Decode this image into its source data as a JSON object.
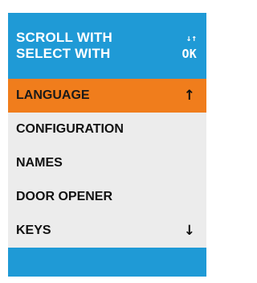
{
  "header": {
    "scroll_label": "SCROLL WITH",
    "scroll_key": "↓↑",
    "select_label": "SELECT WITH",
    "select_key": "OK"
  },
  "menu": {
    "items": [
      {
        "label": "LANGUAGE",
        "selected": true
      },
      {
        "label": "CONFIGURATION",
        "selected": false
      },
      {
        "label": "NAMES",
        "selected": false
      },
      {
        "label": "DOOR OPENER",
        "selected": false
      },
      {
        "label": "KEYS",
        "selected": false
      }
    ],
    "up_arrow": "↑",
    "down_arrow": "↓"
  },
  "colors": {
    "background": "#1f9ad6",
    "selected_highlight": "#f07d1c",
    "list_background": "#ececec"
  }
}
